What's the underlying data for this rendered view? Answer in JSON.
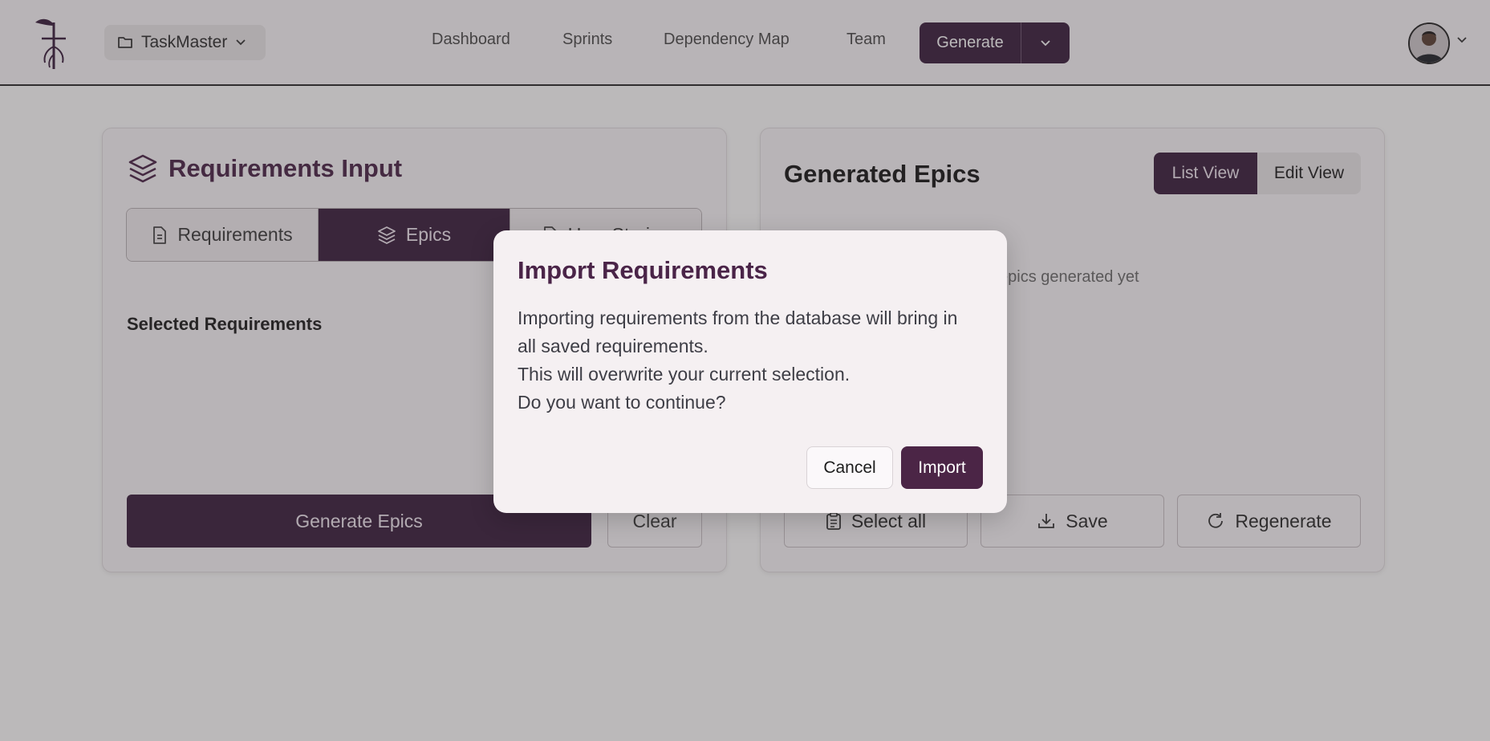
{
  "header": {
    "project": {
      "name": "TaskMaster",
      "icon": "folder-icon"
    },
    "nav": [
      "Dashboard",
      "Sprints",
      "Dependency Map",
      "Team"
    ],
    "generate_label": "Generate"
  },
  "left_panel": {
    "title": "Requirements Input",
    "tabs": [
      {
        "label": "Requirements",
        "icon": "document-icon",
        "active": false
      },
      {
        "label": "Epics",
        "icon": "layers-icon",
        "active": true
      },
      {
        "label": "User Stories",
        "icon": "document-icon",
        "active": false
      }
    ],
    "selected_label": "Selected Requirements",
    "generate_button": "Generate Epics",
    "clear_button": "Clear"
  },
  "right_panel": {
    "title": "Generated Epics",
    "view_toggle": [
      "List View",
      "Edit View"
    ],
    "active_view": "List View",
    "empty_text": "epics generated yet",
    "actions": [
      "Select all",
      "Save",
      "Regenerate"
    ]
  },
  "modal": {
    "title": "Import Requirements",
    "lines": [
      "Importing requirements from the database will bring in",
      "all saved requirements.",
      "This will overwrite your current selection.",
      "Do you want to continue?"
    ],
    "cancel": "Cancel",
    "confirm": "Import"
  },
  "colors": {
    "brand": "#3a1e3d",
    "title_accent": "#4a2448",
    "page_bg": "#fbf8fa",
    "overlay": "rgba(60,55,58,0.35)"
  }
}
